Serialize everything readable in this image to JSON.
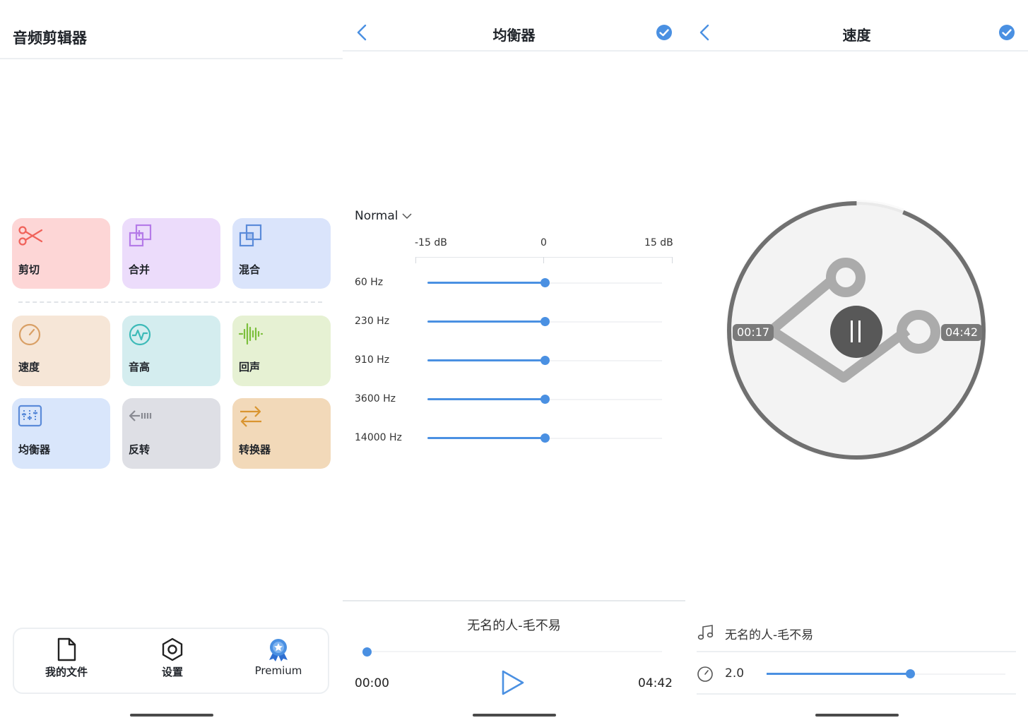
{
  "home": {
    "title": "音频剪辑器",
    "tools": [
      {
        "label": "剪切",
        "icon": "scissors-icon",
        "bg": "#fdd6d6",
        "color": "#f0625a"
      },
      {
        "label": "合并",
        "icon": "merge-icon",
        "bg": "#ecdcfb",
        "color": "#b57be8"
      },
      {
        "label": "混合",
        "icon": "mix-icon",
        "bg": "#dae4fb",
        "color": "#5b8bd9"
      },
      {
        "label": "速度",
        "icon": "speed-icon",
        "bg": "#f6e6d7",
        "color": "#d9a066"
      },
      {
        "label": "音高",
        "icon": "pitch-icon",
        "bg": "#d4edef",
        "color": "#3dbab8"
      },
      {
        "label": "回声",
        "icon": "echo-icon",
        "bg": "#e6f1d3",
        "color": "#7cbf3c"
      },
      {
        "label": "均衡器",
        "icon": "equalizer-icon",
        "bg": "#d9e6fb",
        "color": "#5b8bd9"
      },
      {
        "label": "反转",
        "icon": "reverse-icon",
        "bg": "#dedfe5",
        "color": "#888a92"
      },
      {
        "label": "转换器",
        "icon": "convert-icon",
        "bg": "#f2d9b9",
        "color": "#d99530"
      }
    ],
    "nav": [
      {
        "label": "我的文件",
        "icon": "file-icon"
      },
      {
        "label": "设置",
        "icon": "settings-icon"
      },
      {
        "label": "Premium",
        "icon": "premium-badge-icon"
      }
    ]
  },
  "equalizer": {
    "title": "均衡器",
    "preset": "Normal",
    "scale": {
      "min_label": "-15 dB",
      "mid_label": "0",
      "max_label": "15 dB",
      "min": -15,
      "max": 15
    },
    "bands": [
      {
        "label": "60 Hz",
        "gain": 0
      },
      {
        "label": "230 Hz",
        "gain": 0
      },
      {
        "label": "910 Hz",
        "gain": 0
      },
      {
        "label": "3600 Hz",
        "gain": 0
      },
      {
        "label": "14000 Hz",
        "gain": 0
      }
    ],
    "player": {
      "song": "无名的人-毛不易",
      "current_time": "00:00",
      "total_time": "04:42",
      "progress": 0
    }
  },
  "speed": {
    "title": "速度",
    "current_time": "00:17",
    "total_time": "04:42",
    "playback_progress": 0.06,
    "song": "无名的人-毛不易",
    "speed_value": "2.0",
    "speed_level": 0.6
  },
  "colors": {
    "accent": "#4a90e2",
    "text": "#1f2329",
    "divider": "#eceff2"
  }
}
